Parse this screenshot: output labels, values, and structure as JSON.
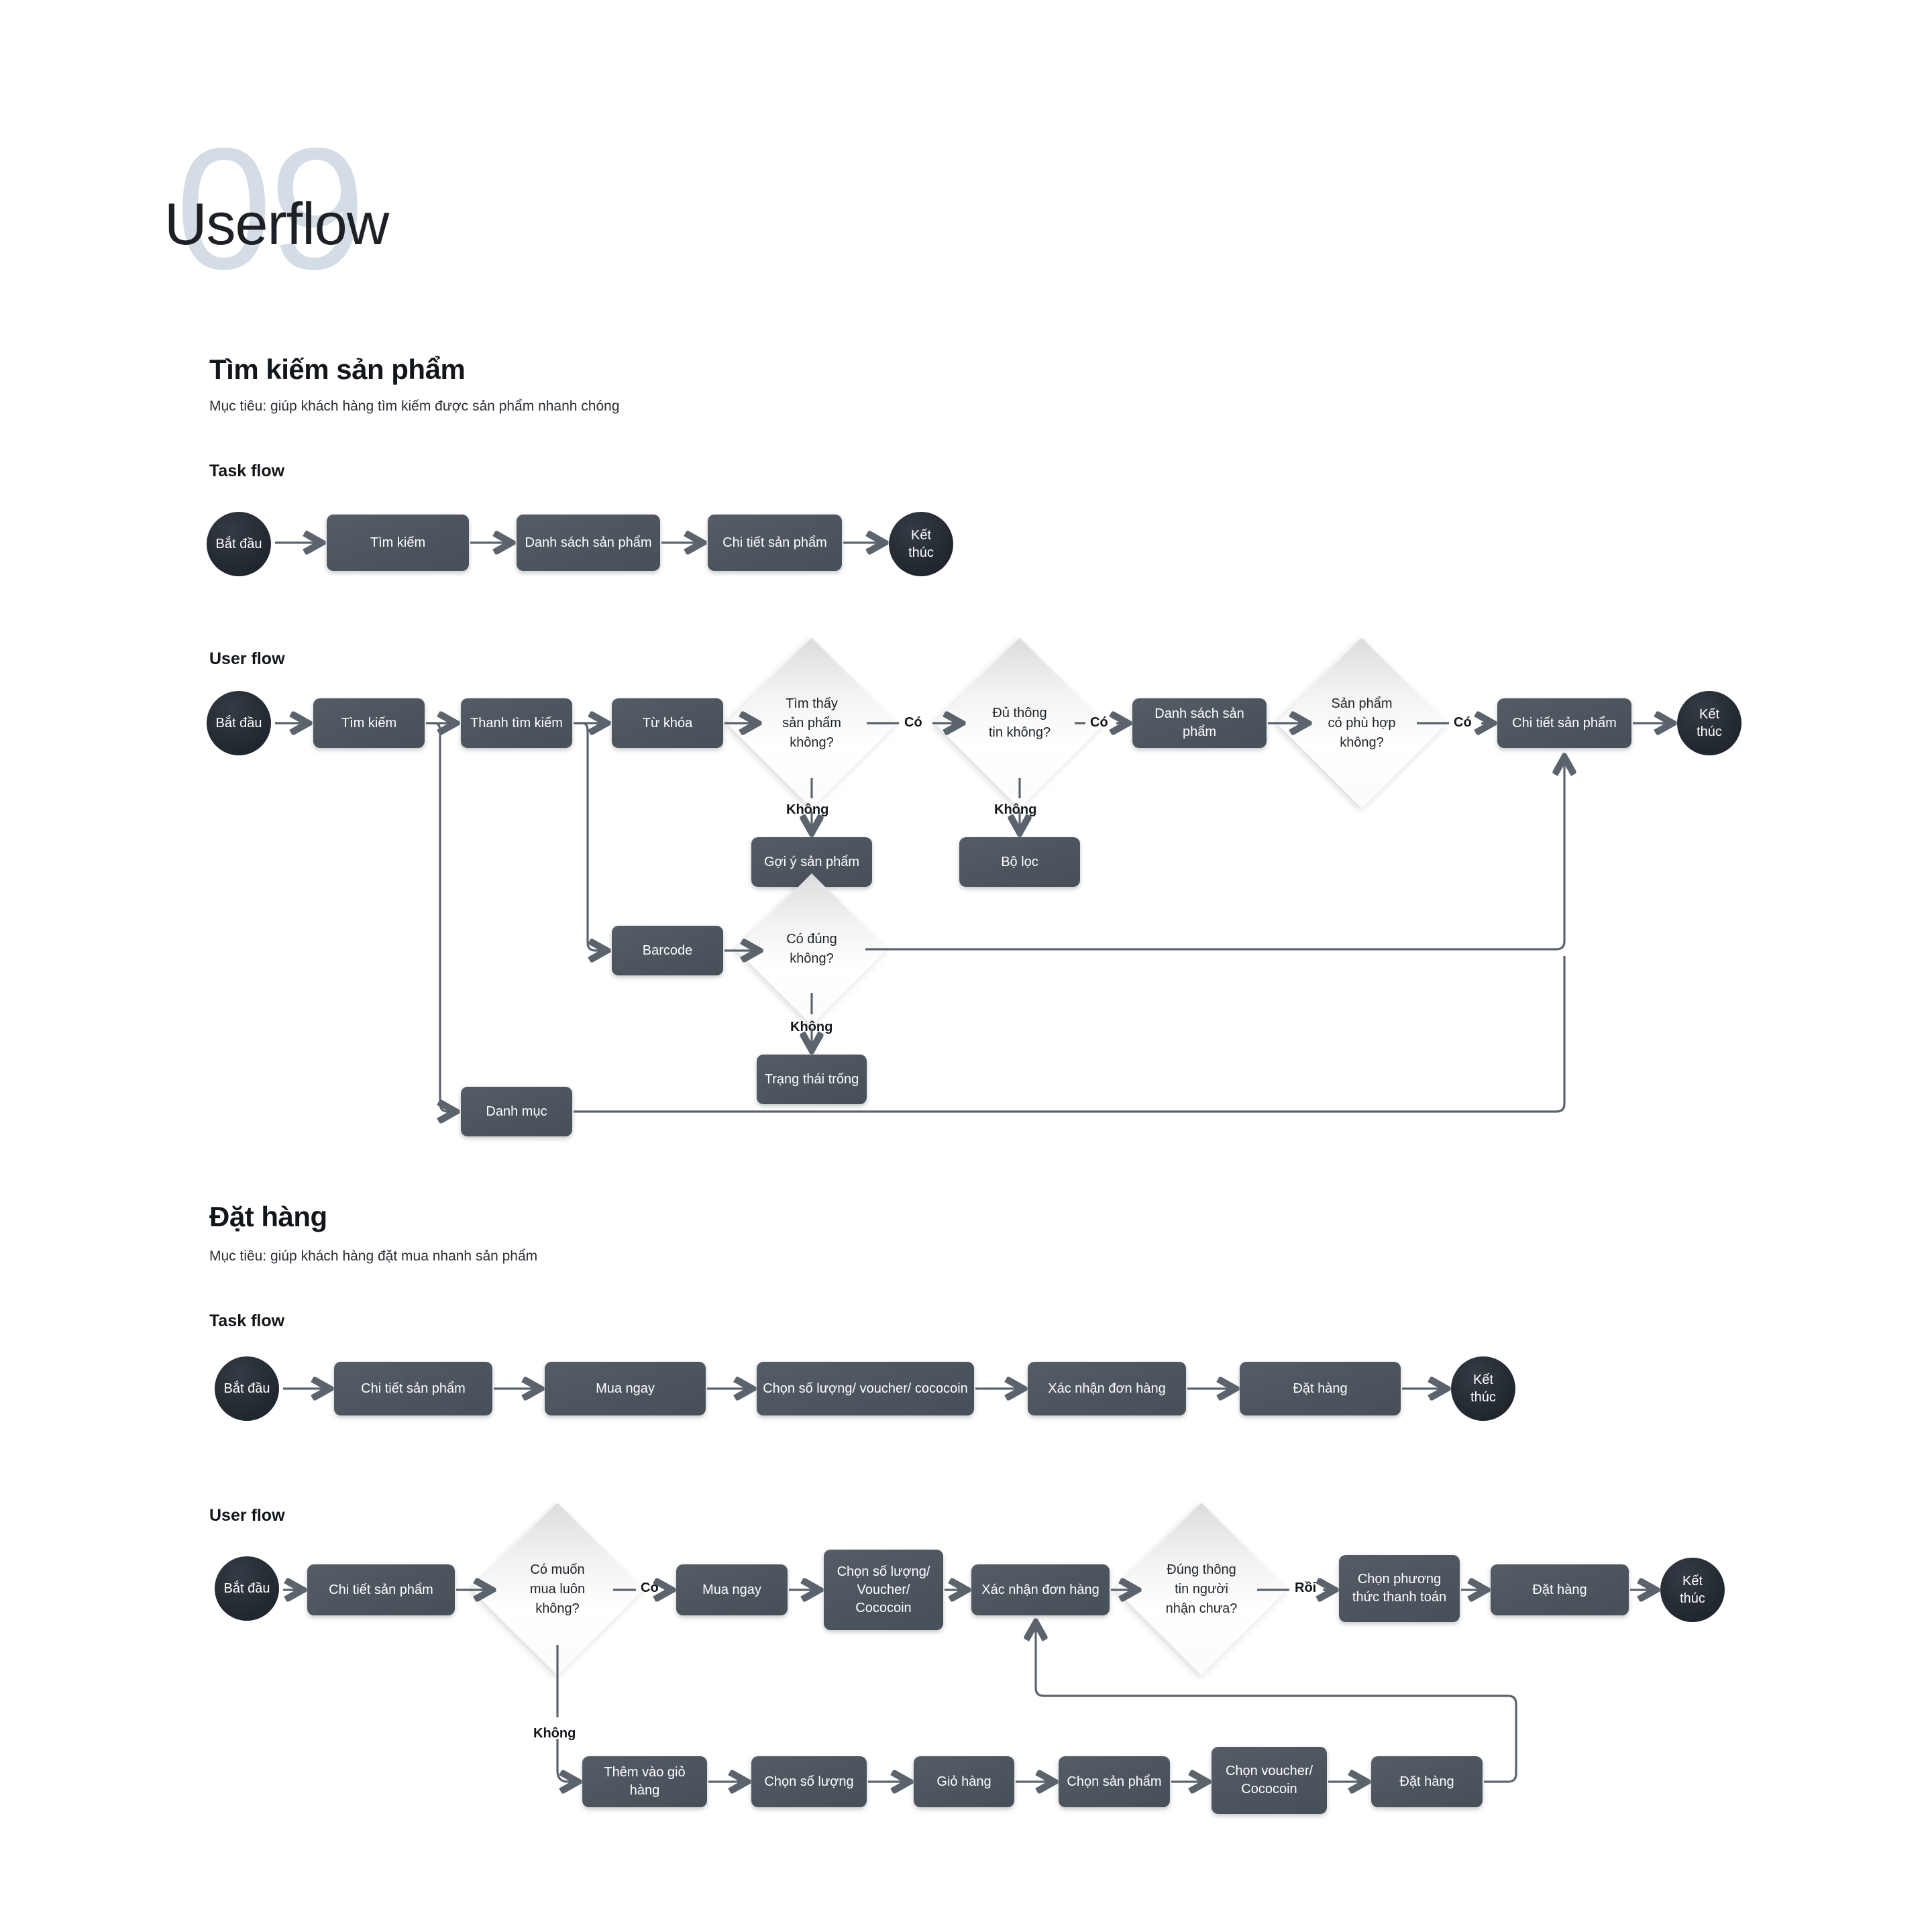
{
  "header": {
    "number": "09",
    "title": "Userflow"
  },
  "sections": [
    {
      "id": "search",
      "title": "Tìm kiếm sản phẩm",
      "subtitle": "Mục tiêu: giúp khách hàng tìm kiếm được sản phẩm nhanh chóng",
      "task_flow_label": "Task flow",
      "user_flow_label": "User flow",
      "task_flow": {
        "start": "Bắt đầu",
        "end_line1": "Kết",
        "end_line2": "thúc",
        "steps": [
          "Tìm kiếm",
          "Danh sách sản phẩm",
          "Chi tiết sản phẩm"
        ]
      },
      "user_flow": {
        "start": "Bắt đầu",
        "end_line1": "Kết",
        "end_line2": "thúc",
        "nodes": {
          "search": "Tìm kiếm",
          "search_bar": "Thanh tìm kiếm",
          "keyword": "Từ khóa",
          "suggest": "Gợi ý sản phẩm",
          "filter": "Bộ lọc",
          "product_list": "Danh sách sản phẩm",
          "product_detail": "Chi tiết sản phẩm",
          "barcode": "Barcode",
          "empty_state": "Trạng thái trống",
          "category": "Danh mục"
        },
        "decisions": {
          "found": "Tìm thấy\nsản phẩm\nkhông?",
          "enough_info": "Đủ thông\ntin không?",
          "suitable": "Sản phẩm\ncó phù hợp\nkhông?",
          "correct": "Có đúng\nkhông?"
        },
        "labels": {
          "yes": "Có",
          "no": "Không"
        }
      }
    },
    {
      "id": "order",
      "title": "Đặt hàng",
      "subtitle": "Mục tiêu: giúp khách hàng đặt mua nhanh sản phẩm",
      "task_flow_label": "Task flow",
      "user_flow_label": "User flow",
      "task_flow": {
        "start": "Bắt đầu",
        "end_line1": "Kết",
        "end_line2": "thúc",
        "steps": [
          "Chi tiết sản phẩm",
          "Mua ngay",
          "Chọn số lượng/ voucher/ cococoin",
          "Xác nhận đơn hàng",
          "Đặt hàng"
        ]
      },
      "user_flow": {
        "start": "Bắt đầu",
        "end_line1": "Kết",
        "end_line2": "thúc",
        "nodes": {
          "product_detail": "Chi tiết sản phẩm",
          "buy_now": "Mua ngay",
          "choose_qty_voucher": "Chọn số lượng/\nVoucher/\nCococoin",
          "confirm_order": "Xác nhận đơn hàng",
          "payment_method": "Chọn phương\nthức thanh toán",
          "place_order": "Đặt hàng",
          "add_to_cart": "Thêm vào giỏ hàng",
          "choose_qty": "Chọn số lượng",
          "cart": "Giỏ hàng",
          "choose_product": "Chọn sản phẩm",
          "choose_voucher": "Chọn voucher/\nCococoin",
          "place_order_cart": "Đặt hàng"
        },
        "decisions": {
          "buy_now_q": "Có muốn\nmua luôn\nkhông?",
          "receiver_info_q": "Đúng thông\ntin người\nnhận chưa?"
        },
        "labels": {
          "yes": "Có",
          "no": "Không",
          "already": "Rồi"
        }
      }
    }
  ],
  "colors": {
    "node_fill": "#4e5660",
    "terminal_fill": "#252b33",
    "wire": "#5b636d",
    "big_number": "#d4dce5",
    "heading": "#12161a"
  }
}
